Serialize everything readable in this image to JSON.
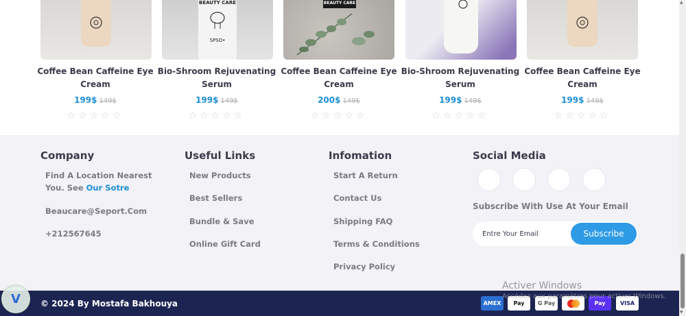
{
  "products": [
    {
      "name": "Coffee Bean Caffeine Eye Cream",
      "price": "199$",
      "old_price": "149$",
      "rating": "☆☆☆☆☆"
    },
    {
      "name": "Bio-Shroom Rejuvenating Serum",
      "price": "199$",
      "old_price": "149$",
      "rating": "☆☆☆☆☆",
      "bottle_label": "BEAUTY CARE",
      "bottle_text": "SPSO•"
    },
    {
      "name": "Coffee Bean Caffeine Eye Cream",
      "price": "200$",
      "old_price": "149$",
      "rating": "☆☆☆☆☆",
      "bottle_label": "BEAUTY CARE"
    },
    {
      "name": "Bio-Shroom Rejuvenating Serum",
      "price": "199$",
      "old_price": "149$",
      "rating": "☆☆☆☆☆"
    },
    {
      "name": "Coffee Bean Caffeine Eye Cream",
      "price": "199$",
      "old_price": "149$",
      "rating": "☆☆☆☆☆"
    }
  ],
  "footer": {
    "company": {
      "title": "Company",
      "address_line1": "Find A Location Nearest",
      "address_line2": "You. See ",
      "store_link": "Our Sotre",
      "email": "Beaucare@Seport.Com",
      "phone": "+212567645"
    },
    "useful_links": {
      "title": "Useful Links",
      "items": [
        "New Products",
        "Best Sellers",
        "Bundle & Save",
        "Online Gift Card"
      ]
    },
    "information": {
      "title": "Infomation",
      "items": [
        "Start A Return",
        "Contact Us",
        "Shipping FAQ",
        "Terms & Conditions",
        "Privacy Policy"
      ]
    },
    "social": {
      "title": "Social Media",
      "subscribe_text": "Subscribe With Use At Your Email",
      "email_placeholder": "Entre Your Email",
      "subscribe_label": "Subscribe"
    }
  },
  "bottom_bar": {
    "copyright": "© 2024 By Mostafa Bakhouya",
    "payments": [
      "AMEX",
      "Pay",
      "G Pay",
      "mastercard",
      "Pay",
      "VISA"
    ]
  },
  "watermark": {
    "title": "Activer Windows",
    "subtitle": "Accédez aux paramètres pour activer Windows."
  },
  "colors": {
    "accent": "#1d8fd6",
    "footer_bg": "#f2f2f7",
    "bottom_bar": "#1c2452"
  }
}
